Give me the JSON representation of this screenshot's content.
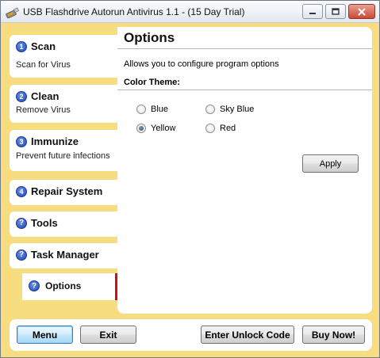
{
  "window": {
    "title": "USB Flashdrive Autorun Antivirus 1.1 - (15 Day Trial)",
    "icon": "usb-drive-icon"
  },
  "sidebar": {
    "items": [
      {
        "num": "1",
        "title": "Scan",
        "subtitle": "Scan for Virus",
        "icon": "number-badge-icon"
      },
      {
        "num": "2",
        "title": "Clean",
        "subtitle": "Remove Virus",
        "icon": "number-badge-icon"
      },
      {
        "num": "3",
        "title": "Immunize",
        "subtitle": "Prevent future infections",
        "icon": "number-badge-icon"
      },
      {
        "num": "4",
        "title": "Repair System",
        "icon": "number-badge-icon"
      },
      {
        "title": "Tools",
        "icon": "help-circle-icon"
      },
      {
        "title": "Task Manager",
        "icon": "help-circle-icon"
      },
      {
        "title": "Options",
        "icon": "help-circle-icon",
        "selected": true
      }
    ],
    "question_glyph": "?"
  },
  "panel": {
    "title": "Options",
    "description": "Allows you to configure program options",
    "color_theme_label": "Color Theme:",
    "themes": [
      {
        "label": "Blue",
        "selected": false
      },
      {
        "label": "Sky Blue",
        "selected": false
      },
      {
        "label": "Yellow",
        "selected": true
      },
      {
        "label": "Red",
        "selected": false
      }
    ],
    "apply_label": "Apply"
  },
  "bottom": {
    "menu_label": "Menu",
    "exit_label": "Exit",
    "unlock_label": "Enter Unlock Code",
    "buy_label": "Buy Now!"
  },
  "colors": {
    "theme_background": "#f8dc80",
    "selected_accent": "#d01010",
    "badge_blue": "#1d46b8"
  }
}
